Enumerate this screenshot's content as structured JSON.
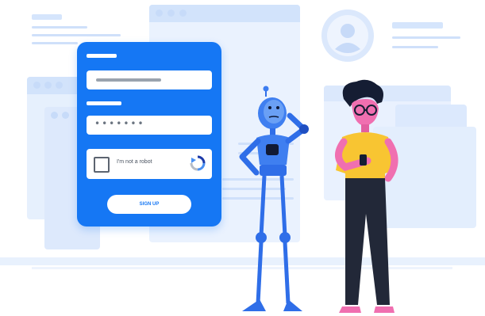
{
  "signup_card": {
    "password_mask": "•••••••",
    "captcha_label": "I'm not a robot",
    "submit_label": "SIGN UP"
  },
  "colors": {
    "card": "#1577f4",
    "background_windows": "#e6f0fd",
    "robot_body": "#2f6ee8",
    "person_shirt": "#f8c532",
    "person_skin": "#f06fb0",
    "person_hair": "#151d33",
    "person_pants": "#222838"
  },
  "icons": [
    "recaptcha-icon",
    "user-avatar-icon"
  ]
}
